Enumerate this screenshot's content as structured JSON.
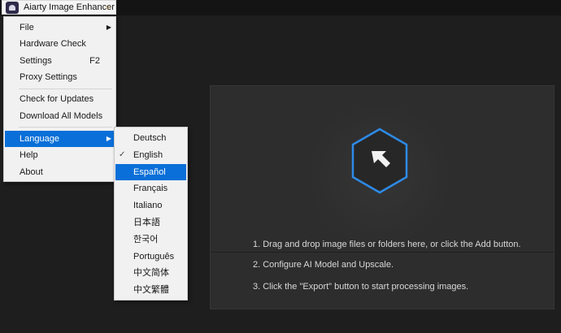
{
  "app": {
    "title": "Aiarty Image Enhancer",
    "chevron": "⌵"
  },
  "main_menu": {
    "file": "File",
    "hardware_check": "Hardware Check",
    "settings": "Settings",
    "settings_shortcut": "F2",
    "proxy_settings": "Proxy Settings",
    "check_updates": "Check for Updates",
    "download_models": "Download All Models",
    "language": "Language",
    "help": "Help",
    "about": "About"
  },
  "language_menu": {
    "items": [
      "Deutsch",
      "English",
      "Español",
      "Français",
      "Italiano",
      "日本語",
      "한국어",
      "Português",
      "中文简体",
      "中文繁體"
    ],
    "checked": "English",
    "highlighted": "Español",
    "check_mark": "✓"
  },
  "drop_area": {
    "step1": "1. Drag and drop image files or folders here, or click the Add button.",
    "step2": "2. Configure AI Model and Upscale.",
    "step3": "3. Click the \"Export\" button to start processing images."
  },
  "colors": {
    "accent": "#0a6fd8",
    "hex_border": "#2e8ae6",
    "background": "#1e1e1e",
    "panel": "#2d2d2d"
  },
  "icons": {
    "submenu_arrow": "▶"
  }
}
